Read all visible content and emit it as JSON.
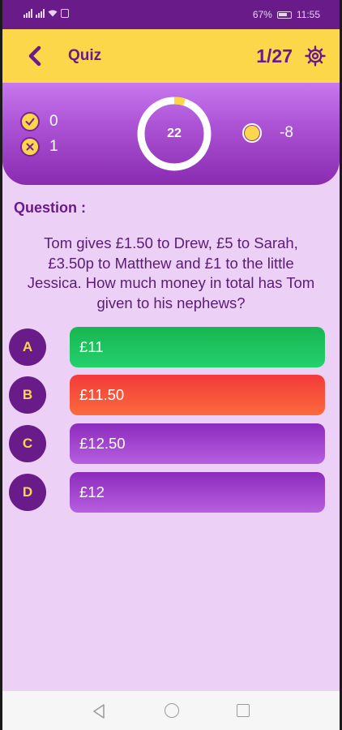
{
  "status_bar": {
    "battery": "67%",
    "time": "11:55"
  },
  "app_bar": {
    "title": "Quiz",
    "counter": "1/27"
  },
  "score": {
    "correct": "0",
    "wrong": "1",
    "timer": "22",
    "timer_progress": 0.05,
    "coins": "-8"
  },
  "question": {
    "label": "Question :",
    "text": "Tom gives £1.50 to Drew, £5 to Sarah, £3.50p to Matthew and £1 to the little Jessica. How much money in total has Tom given to his nephews?"
  },
  "options": [
    {
      "letter": "A",
      "text": "£11",
      "state": "correct"
    },
    {
      "letter": "B",
      "text": "£11.50",
      "state": "wrong"
    },
    {
      "letter": "C",
      "text": "£12.50",
      "state": "neutral"
    },
    {
      "letter": "D",
      "text": "£12",
      "state": "neutral"
    }
  ],
  "colors": {
    "primary": "#6a1b8a",
    "accent": "#fdd74a",
    "correct": "#1ec45f",
    "wrong": "#f54a3a",
    "neutral": "#9b3fc6",
    "background": "#ecd0f5"
  }
}
